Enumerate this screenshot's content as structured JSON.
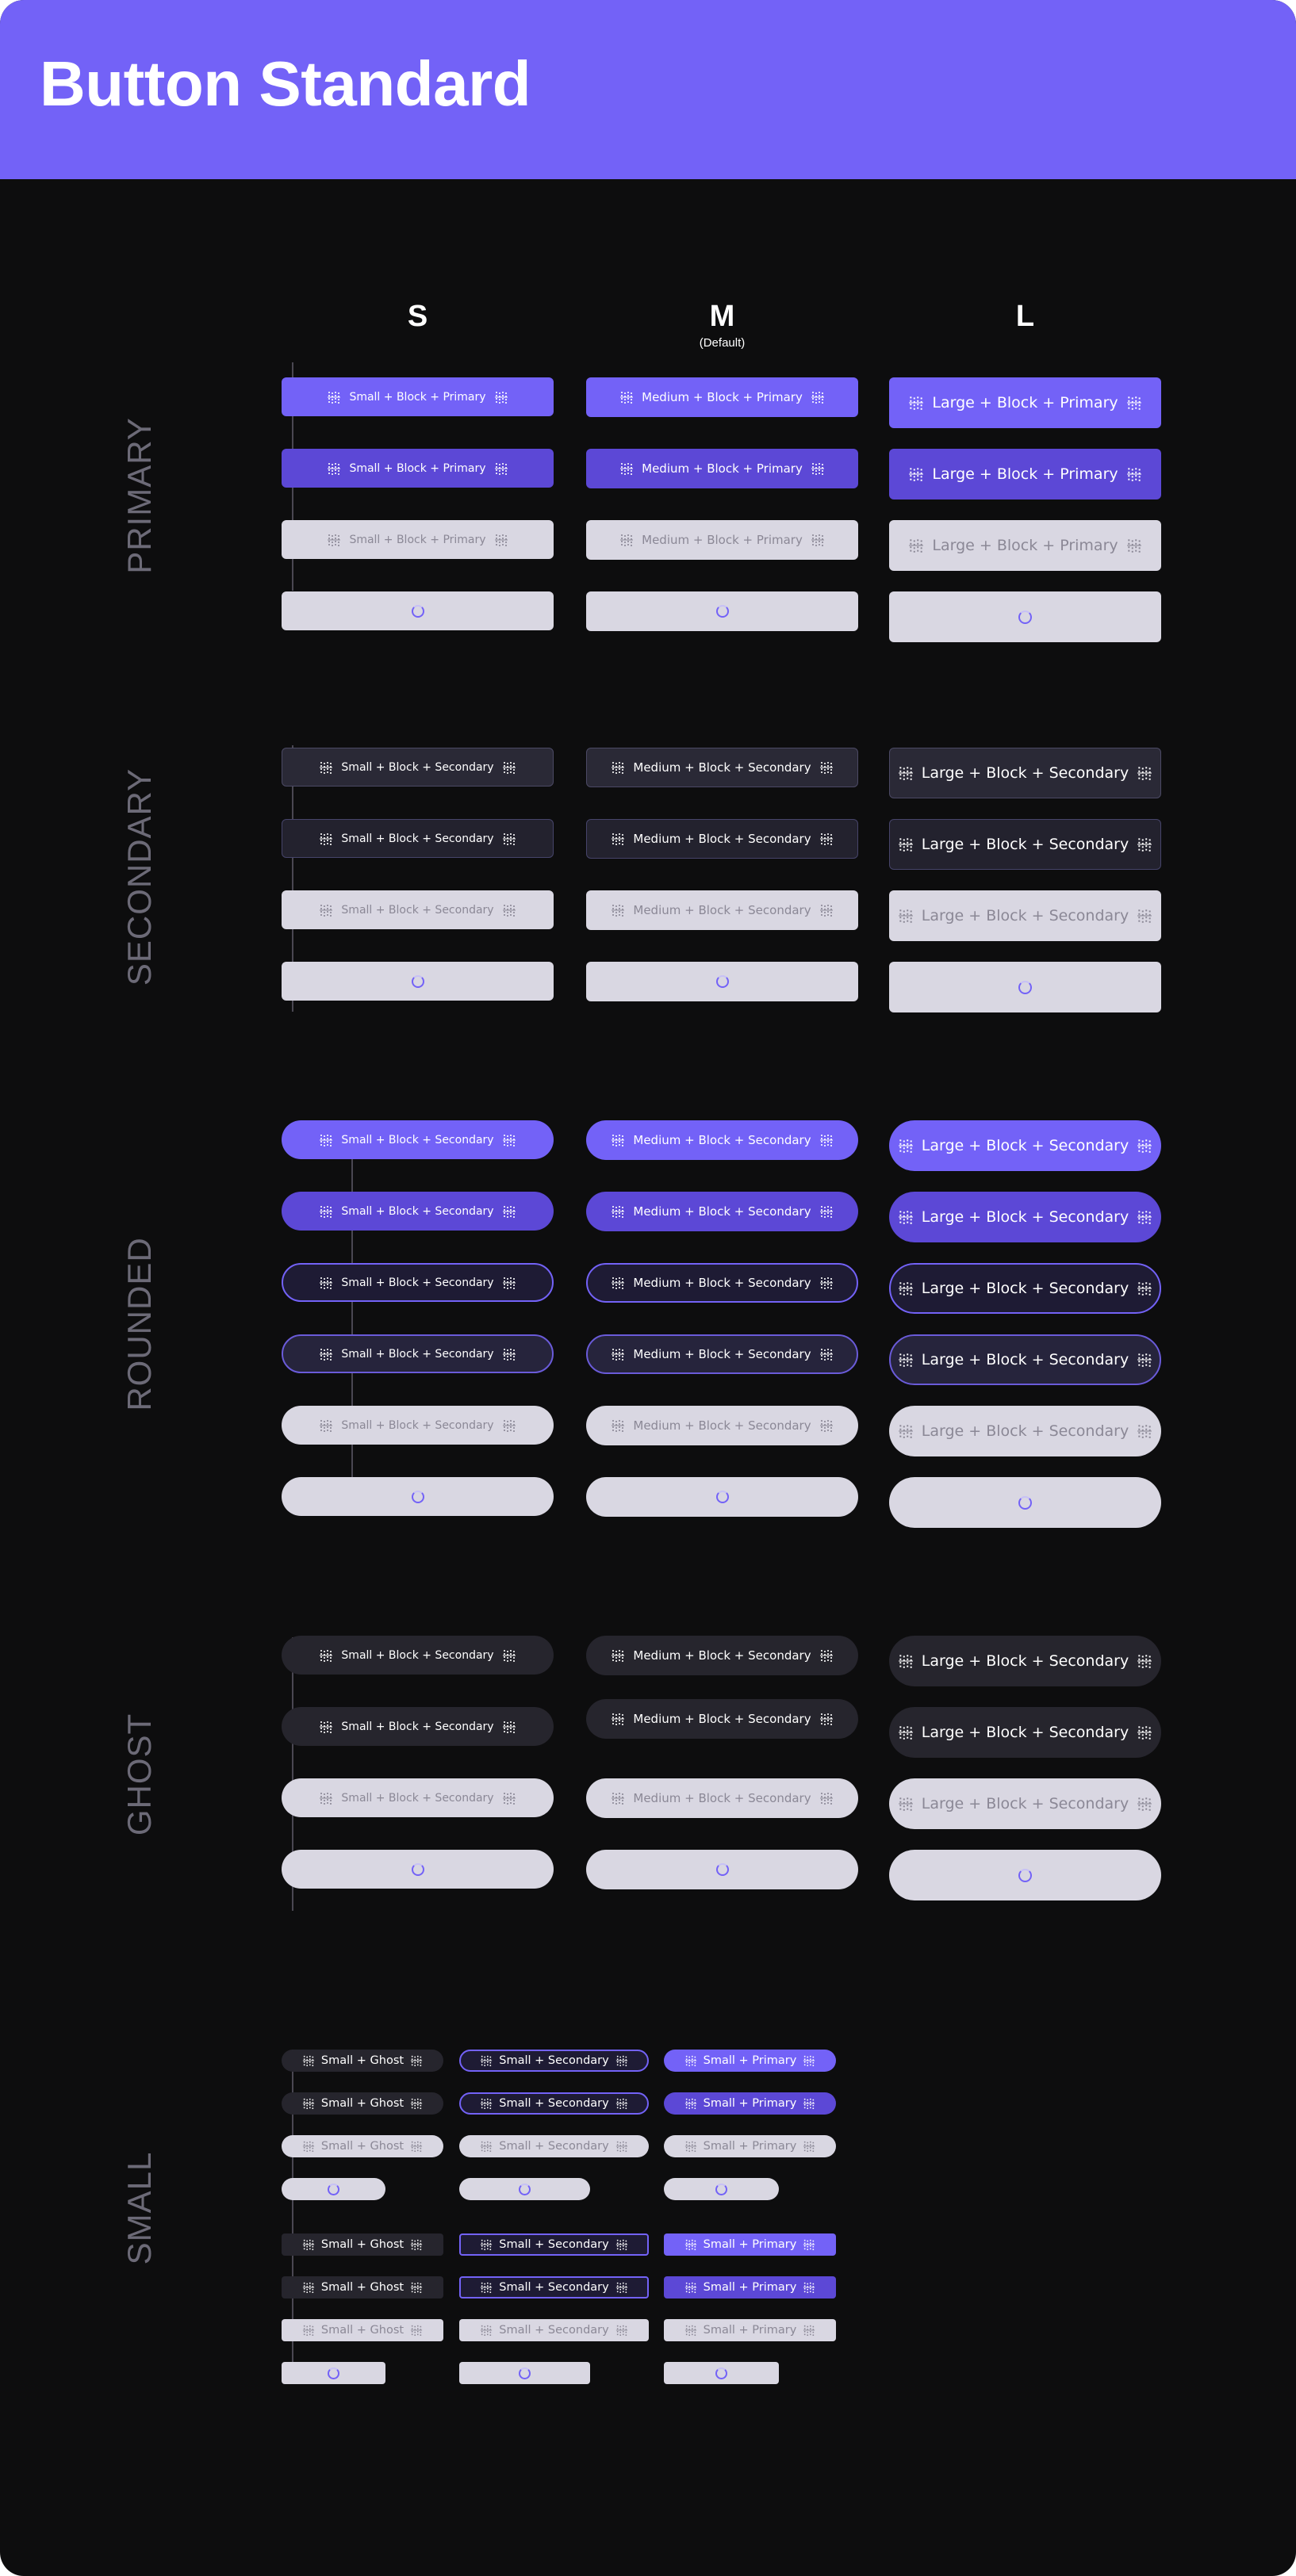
{
  "header": {
    "title": "Button Standard"
  },
  "columns": {
    "s": {
      "label": "S"
    },
    "m": {
      "label": "M",
      "sub": "(Default)"
    },
    "l": {
      "label": "L"
    }
  },
  "sections": {
    "primary": "PRIMARY",
    "secondary": "SECONDARY",
    "rounded": "ROUNDED",
    "ghost": "GHOST",
    "small": "SMALL"
  },
  "colors": {
    "accent": "#7362f7",
    "accent_pressed": "#5c48d6",
    "background": "#0d0d0e",
    "disabled": "#d9d7e2",
    "disabled_text": "#8b8896",
    "secondary_fill": "#2a2936",
    "section_label": "#6c6a77"
  },
  "icons": {
    "button_icon": "sparkle-grid-icon",
    "loading": "spinner-icon"
  },
  "labels": {
    "primary_s": "Small + Block + Primary",
    "primary_m": "Medium + Block + Primary",
    "primary_l": "Large + Block + Primary",
    "secondary_s": "Small + Block + Secondary",
    "secondary_m": "Medium + Block + Secondary",
    "secondary_l": "Large + Block + Secondary",
    "small_ghost": "Small + Ghost",
    "small_secondary": "Small + Secondary",
    "small_primary": "Small + Primary"
  }
}
